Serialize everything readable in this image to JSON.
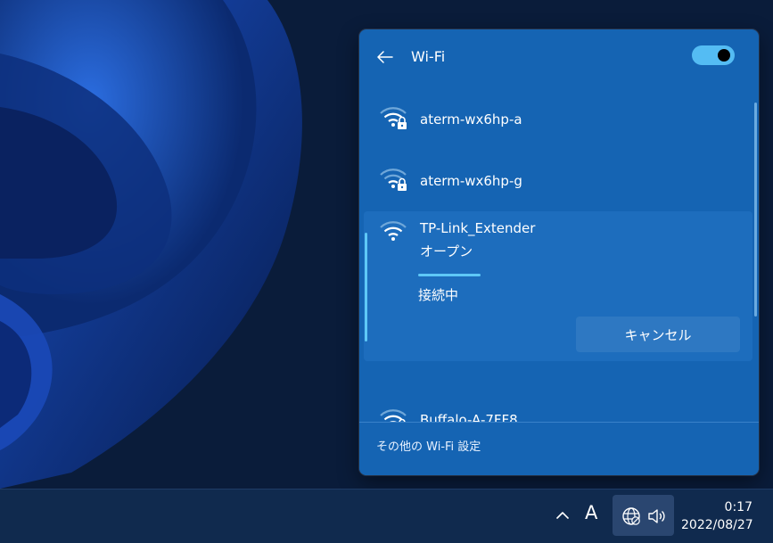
{
  "flyout": {
    "title": "Wi-Fi",
    "wifi_enabled": true,
    "networks": [
      {
        "name": "aterm-wx6hp-a",
        "secured": true
      },
      {
        "name": "aterm-wx6hp-g",
        "secured": true
      },
      {
        "name": "TP-Link_Extender",
        "secured": false,
        "security_label": "オープン",
        "status": "接続中",
        "cancel_label": "キャンセル"
      },
      {
        "name": "Buffalo-A-7FF8",
        "secured": true
      }
    ],
    "footer_link": "その他の Wi-Fi 設定"
  },
  "taskbar": {
    "ime_indicator": "A",
    "clock_time": "0:17",
    "clock_date": "2022/08/27"
  },
  "colors": {
    "flyout_bg": "#1564b3",
    "accent": "#54bcf3",
    "taskbar_bg": "#102a4e"
  }
}
